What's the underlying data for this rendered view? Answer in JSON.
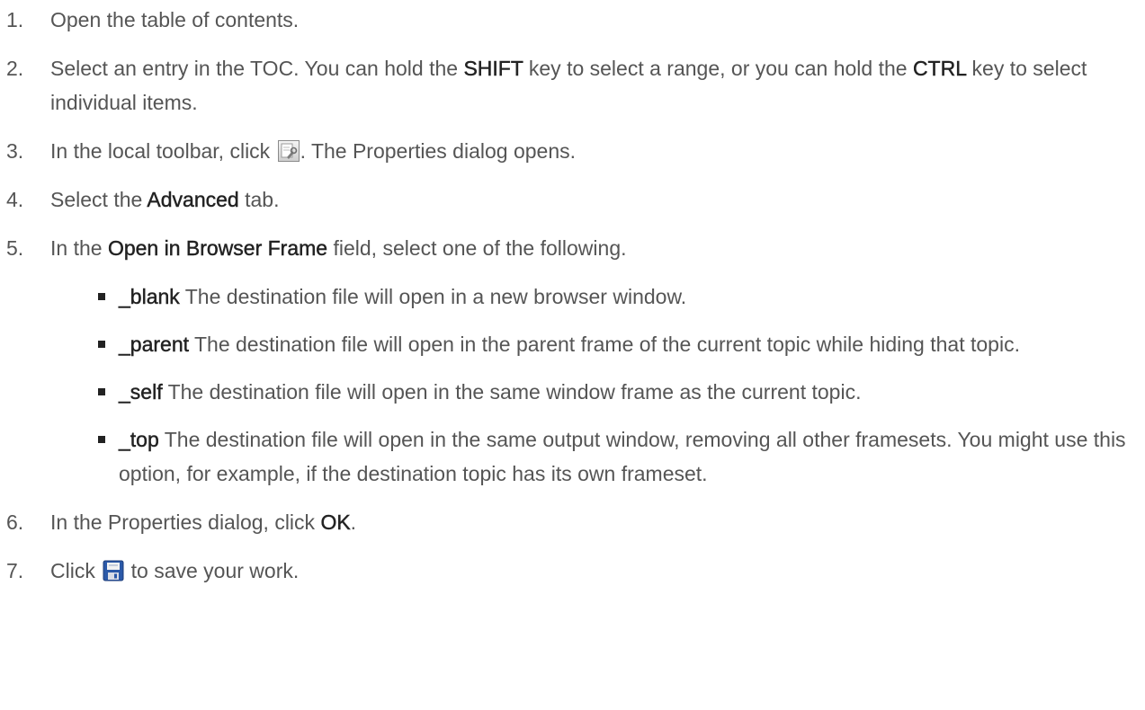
{
  "steps": [
    {
      "number": "1.",
      "parts": [
        {
          "text": "Open the table of contents."
        }
      ]
    },
    {
      "number": "2.",
      "parts": [
        {
          "text": "Select an entry in the TOC. You can hold the "
        },
        {
          "text": "SHIFT",
          "bold": true
        },
        {
          "text": " key to select a range, or you can hold the "
        },
        {
          "text": "CTRL",
          "bold": true
        },
        {
          "text": " key to select individual items."
        }
      ]
    },
    {
      "number": "3.",
      "parts": [
        {
          "text": "In the local toolbar, click "
        },
        {
          "icon": "properties-icon"
        },
        {
          "text": ". The Properties dialog opens."
        }
      ]
    },
    {
      "number": "4.",
      "parts": [
        {
          "text": "Select the "
        },
        {
          "text": "Advanced",
          "bold": true
        },
        {
          "text": " tab."
        }
      ]
    },
    {
      "number": "5.",
      "parts": [
        {
          "text": "In the "
        },
        {
          "text": "Open in Browser Frame",
          "bold": true
        },
        {
          "text": " field, select one of the following."
        }
      ],
      "options": [
        {
          "term": "_blank",
          "description": " The destination file will open in a new browser window."
        },
        {
          "term": "_parent",
          "description": " The destination file will open in the parent frame of the current topic while hiding that topic."
        },
        {
          "term": "_self",
          "description": " The destination file will open in the same window frame as the current topic."
        },
        {
          "term": "_top",
          "description": " The destination file will open in the same output window, removing all other framesets. You might use this option, for example, if the destination topic has its own frameset."
        }
      ]
    },
    {
      "number": "6.",
      "parts": [
        {
          "text": "In the Properties dialog, click "
        },
        {
          "text": "OK",
          "bold": true
        },
        {
          "text": "."
        }
      ]
    },
    {
      "number": "7.",
      "parts": [
        {
          "text": "Click "
        },
        {
          "icon": "save-icon"
        },
        {
          "text": " to save your work."
        }
      ]
    }
  ],
  "colors": {
    "body_text": "#555555",
    "emphasis_text": "#222222",
    "save_icon_blue": "#2b59a8"
  }
}
